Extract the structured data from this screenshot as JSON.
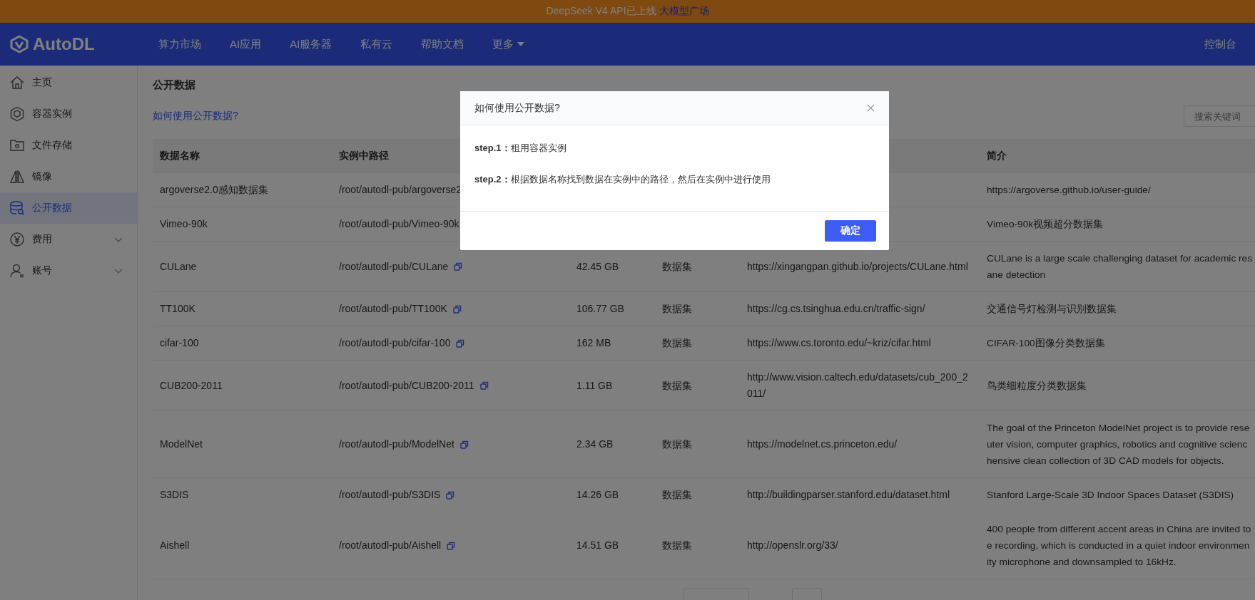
{
  "banner": {
    "text": "DeepSeek V4 API已上线",
    "link": "大模型广场"
  },
  "header": {
    "logo": "AutoDL",
    "nav": [
      {
        "label": "算力市场",
        "kind": "link"
      },
      {
        "label": "AI应用",
        "kind": "link"
      },
      {
        "label": "AI服务器",
        "kind": "link"
      },
      {
        "label": "私有云",
        "kind": "link"
      },
      {
        "label": "帮助文档",
        "kind": "link"
      },
      {
        "label": "更多",
        "kind": "dropdown"
      }
    ],
    "console": "控制台"
  },
  "sidebar": {
    "items": [
      {
        "label": "主页",
        "kind": "link",
        "selected": false
      },
      {
        "label": "容器实例",
        "kind": "link",
        "selected": false
      },
      {
        "label": "文件存储",
        "kind": "link",
        "selected": false
      },
      {
        "label": "镜像",
        "kind": "link",
        "selected": false
      },
      {
        "label": "公开数据",
        "kind": "link",
        "selected": true
      },
      {
        "label": "费用",
        "kind": "group",
        "selected": false
      },
      {
        "label": "账号",
        "kind": "group",
        "selected": false
      }
    ]
  },
  "page": {
    "title": "公开数据",
    "help_link": "如何使用公开数据?",
    "search": {
      "placeholder": "搜索关键词"
    }
  },
  "table": {
    "columns": {
      "name": "数据名称",
      "path": "实例中路径",
      "description": "简介"
    },
    "rows": [
      {
        "name": "argoverse2.0感知数据集",
        "path": "/root/autodl-pub/argoverse2",
        "description": [
          "https://argoverse.github.io/user-guide/"
        ]
      },
      {
        "name": "Vimeo-90k",
        "path": "/root/autodl-pub/Vimeo-90k",
        "description": [
          "Vimeo-90k视频超分数据集"
        ]
      },
      {
        "name": "CULane",
        "path": "/root/autodl-pub/CULane",
        "column_3": "42.45 GB",
        "column_4": "数据集",
        "column_5": "https://xingangpan.github.io/projects/CULane.html",
        "description": [
          "CULane is a large scale challenging dataset for academic res",
          "ane detection"
        ]
      },
      {
        "name": "TT100K",
        "path": "/root/autodl-pub/TT100K",
        "column_3": "106.77 GB",
        "column_4": "数据集",
        "column_5": "https://cg.cs.tsinghua.edu.cn/traffic-sign/",
        "description": [
          "交通信号灯检测与识别数据集"
        ]
      },
      {
        "name": "cifar-100",
        "path": "/root/autodl-pub/cifar-100",
        "column_3": "162 MB",
        "column_4": "数据集",
        "column_5": "https://www.cs.toronto.edu/~kriz/cifar.html",
        "description": [
          "CIFAR-100图像分类数据集"
        ]
      },
      {
        "name": "CUB200-2011",
        "path": "/root/autodl-pub/CUB200-2011",
        "column_3": "1.11 GB",
        "column_4": "数据集",
        "column_5": "http://www.vision.caltech.edu/datasets/cub_200_2011/",
        "description": [
          "鸟类细粒度分类数据集"
        ]
      },
      {
        "name": "ModelNet",
        "path": "/root/autodl-pub/ModelNet",
        "column_3": "2.34 GB",
        "column_4": "数据集",
        "column_5": "https://modelnet.cs.princeton.edu/",
        "description": [
          "The goal of the Princeton ModelNet project is to provide rese",
          "uter vision, computer graphics, robotics and cognitive scienc",
          "hensive clean collection of 3D CAD models for objects."
        ]
      },
      {
        "name": "S3DIS",
        "path": "/root/autodl-pub/S3DIS",
        "column_3": "14.26 GB",
        "column_4": "数据集",
        "column_5": "http://buildingparser.stanford.edu/dataset.html",
        "description": [
          "Stanford Large-Scale 3D Indoor Spaces Dataset (S3DIS)"
        ]
      },
      {
        "name": "Aishell",
        "path": "/root/autodl-pub/Aishell",
        "column_3": "14.51 GB",
        "column_4": "数据集",
        "column_5": "http://openslr.org/33/",
        "description": [
          "400 people from different accent areas in China are invited to",
          "e recording, which is conducted in a quiet indoor environmen",
          "ity microphone and downsampled to 16kHz."
        ]
      }
    ]
  },
  "dialog": {
    "title": "如何使用公开数据?",
    "steps": [
      {
        "label": "step.1：",
        "text": "租用容器实例"
      },
      {
        "label": "step.2：",
        "text": "根据数据名称找到数据在实例中的路径，然后在实例中进行使用"
      }
    ],
    "confirm": "确定"
  }
}
